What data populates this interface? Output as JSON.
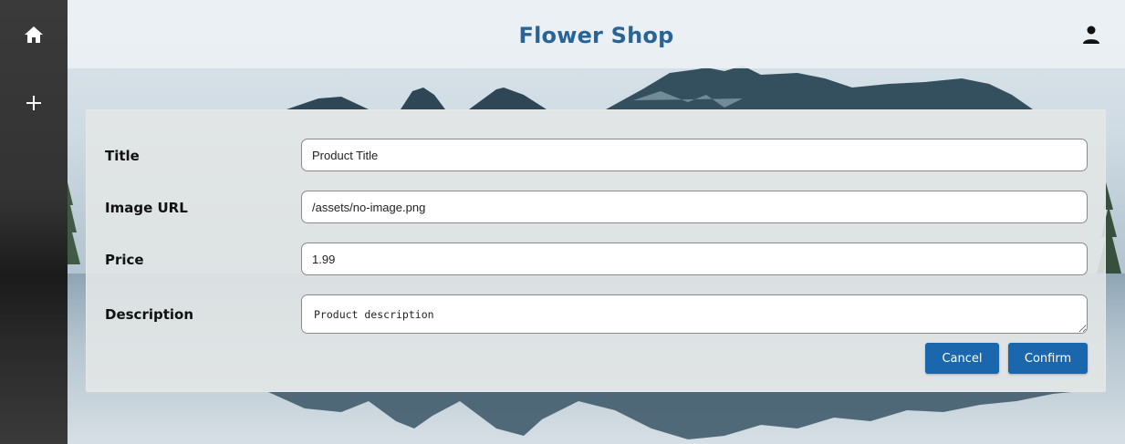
{
  "header": {
    "title": "Flower Shop"
  },
  "sidebar": {
    "items": [
      {
        "icon": "home-icon"
      },
      {
        "icon": "plus-icon"
      }
    ]
  },
  "form": {
    "fields": [
      {
        "label": "Title",
        "value": "Product Title"
      },
      {
        "label": "Image URL",
        "value": "/assets/no-image.png"
      },
      {
        "label": "Price",
        "value": "1.99"
      },
      {
        "label": "Description",
        "value": "Product description"
      }
    ],
    "cancel_label": "Cancel",
    "confirm_label": "Confirm"
  },
  "colors": {
    "title": "#2a6496",
    "button": "#1a67ae",
    "sidebar": "#333333"
  }
}
